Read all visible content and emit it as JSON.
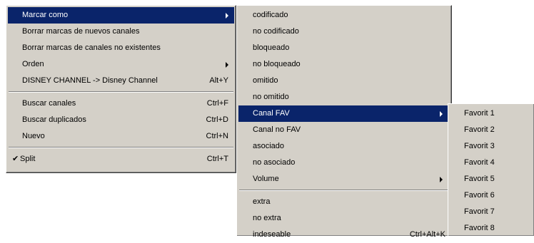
{
  "menu_main": {
    "items": [
      {
        "label": "Marcar como",
        "shortcut": "",
        "submenu": true,
        "highlighted": true
      },
      {
        "label": "Borrar marcas de nuevos canales",
        "shortcut": ""
      },
      {
        "label": "Borrar marcas de canales no existentes",
        "shortcut": ""
      },
      {
        "label": "Orden",
        "shortcut": "",
        "submenu": true
      },
      {
        "label": "DISNEY CHANNEL -> Disney Channel",
        "shortcut": "Alt+Y"
      },
      {
        "label": "Buscar canales",
        "shortcut": "Ctrl+F"
      },
      {
        "label": "Buscar duplicados",
        "shortcut": "Ctrl+D"
      },
      {
        "label": "Nuevo",
        "shortcut": "Ctrl+N"
      },
      {
        "label": "Split",
        "shortcut": "Ctrl+T",
        "checked": true
      }
    ],
    "check_glyph": "✔"
  },
  "menu_marcar": {
    "items": [
      {
        "label": "codificado"
      },
      {
        "label": "no codificado"
      },
      {
        "label": "bloqueado"
      },
      {
        "label": "no bloqueado"
      },
      {
        "label": "omitido"
      },
      {
        "label": "no omitido"
      },
      {
        "label": "Canal FAV",
        "submenu": true,
        "highlighted": true
      },
      {
        "label": "Canal no FAV"
      },
      {
        "label": "asociado"
      },
      {
        "label": "no asociado"
      },
      {
        "label": "Volume",
        "submenu": true
      },
      {
        "label": "extra"
      },
      {
        "label": "no extra"
      },
      {
        "label": "indeseable",
        "shortcut": "Ctrl+Alt+K"
      }
    ]
  },
  "menu_fav": {
    "items": [
      {
        "label": "Favorit 1"
      },
      {
        "label": "Favorit 2"
      },
      {
        "label": "Favorit 3"
      },
      {
        "label": "Favorit 4"
      },
      {
        "label": "Favorit 5"
      },
      {
        "label": "Favorit 6"
      },
      {
        "label": "Favorit 7"
      },
      {
        "label": "Favorit 8"
      }
    ]
  },
  "colors": {
    "menu_bg": "#d4d0c8",
    "highlight_bg": "#0a246a",
    "highlight_text": "#ffffff"
  }
}
